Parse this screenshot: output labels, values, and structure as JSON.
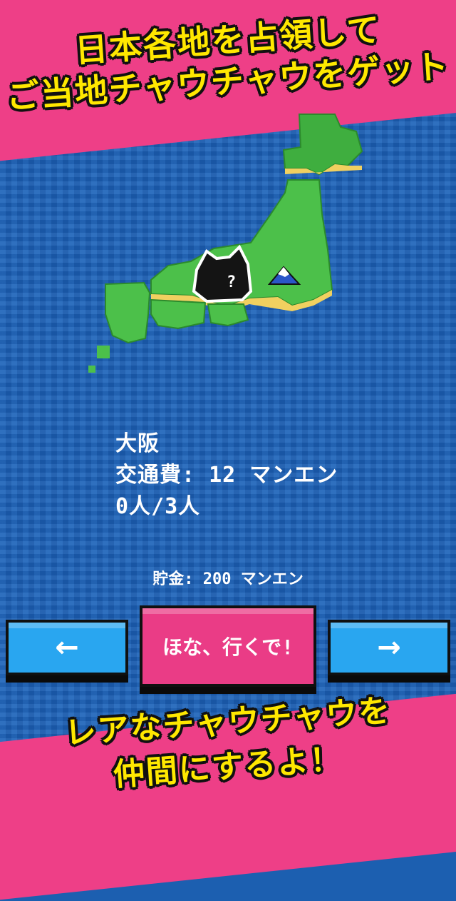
{
  "promo": {
    "top_line1": "日本各地を占領して",
    "top_line2": "ご当地チャウチャウをゲット",
    "bottom_line1": "レアなチャウチャウを",
    "bottom_line2": "仲間にするよ！"
  },
  "destination": {
    "city": "大阪",
    "fare": "交通費: 12 マンエン",
    "people": "0人/3人"
  },
  "savings": "貯金: 200 マンエン",
  "controls": {
    "prev_label": "←",
    "go_label": "ほな、行くで!",
    "next_label": "→"
  },
  "marker": {
    "glyph": "?"
  },
  "colors": {
    "accent_pink": "#ee3f87",
    "headline_yellow": "#ffe800",
    "button_blue": "#29a6f0",
    "sea_blue": "#1d62b6",
    "land_green": "#4cc04a"
  }
}
